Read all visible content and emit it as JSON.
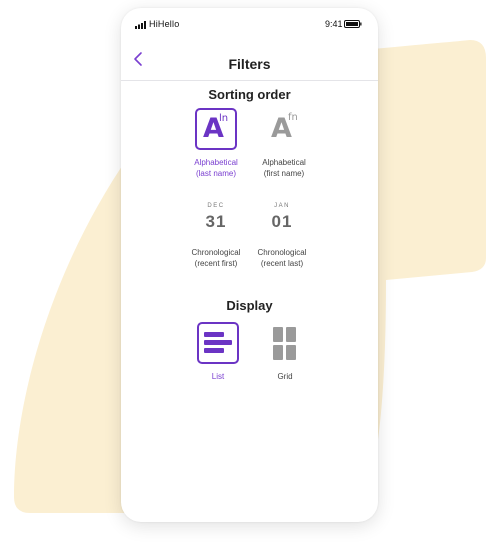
{
  "status_bar": {
    "carrier": "HiHello",
    "time": "9:41"
  },
  "nav": {
    "title": "Filters",
    "back_icon": "chevron-left-icon"
  },
  "sorting": {
    "title": "Sorting order",
    "options": [
      {
        "icon_letter": "A",
        "icon_sup": "ln",
        "line1": "Alphabetical",
        "line2": "(last name)",
        "selected": true
      },
      {
        "icon_letter": "A",
        "icon_sup": "fn",
        "line1": "Alphabetical",
        "line2": "(first name)",
        "selected": false
      },
      {
        "icon_month": "DEC",
        "icon_day": "31",
        "line1": "Chronological",
        "line2": "(recent first)",
        "selected": false
      },
      {
        "icon_month": "JAN",
        "icon_day": "01",
        "line1": "Chronological",
        "line2": "(recent last)",
        "selected": false
      }
    ]
  },
  "display": {
    "title": "Display",
    "options": [
      {
        "label": "List",
        "icon": "list-icon",
        "selected": true
      },
      {
        "label": "Grid",
        "icon": "grid-icon",
        "selected": false
      }
    ]
  },
  "colors": {
    "accent": "#6b34c4",
    "accent_text": "#7a3fd0",
    "inactive_icon": "#9a9a9a",
    "background_blob": "#fbefd2"
  }
}
